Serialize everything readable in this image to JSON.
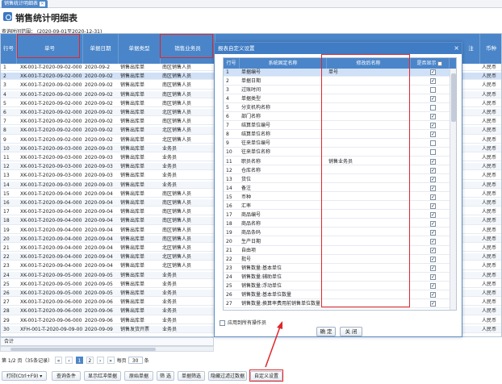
{
  "tab": {
    "label": "销售统计明细表"
  },
  "page": {
    "title": "销售统计明细表",
    "query_range": "查询时间范围： (2020-09-01至2020-12-31)"
  },
  "grid": {
    "headers": {
      "row": "行号",
      "bill_no": "单号",
      "date": "单据日期",
      "type": "单据类型",
      "staff": "销售业务员",
      "currency": "币种",
      "note": "注"
    },
    "rows": [
      {
        "row": "1",
        "bill_no": "XK-001-T-2020-09-02-000",
        "date": "2020-09-2",
        "type": "销售出库单",
        "staff": "南区销售人员",
        "currency": "人民币"
      },
      {
        "row": "2",
        "bill_no": "XK-001-T-2020-09-02-000",
        "date": "2020-09-02",
        "type": "销售出库单",
        "staff": "南区销售人员",
        "currency": "人民币"
      },
      {
        "row": "3",
        "bill_no": "XK-001-T-2020-09-02-000",
        "date": "2020-09-02",
        "type": "销售出库单",
        "staff": "南区销售人员",
        "currency": "人民币"
      },
      {
        "row": "4",
        "bill_no": "XK-001-T-2020-09-02-000",
        "date": "2020-09-02",
        "type": "销售出库单",
        "staff": "南区销售人员",
        "currency": "人民币"
      },
      {
        "row": "5",
        "bill_no": "XK-001-T-2020-09-02-000",
        "date": "2020-09-02",
        "type": "销售出库单",
        "staff": "南区销售人员",
        "currency": "人民币"
      },
      {
        "row": "6",
        "bill_no": "XK-001-T-2020-09-02-000",
        "date": "2020-09-02",
        "type": "销售出库单",
        "staff": "北区销售人员",
        "currency": "人民币"
      },
      {
        "row": "7",
        "bill_no": "XK-001-T-2020-09-02-000",
        "date": "2020-09-02",
        "type": "销售出库单",
        "staff": "南区销售人员",
        "currency": "人民币"
      },
      {
        "row": "8",
        "bill_no": "XK-001-T-2020-09-02-000",
        "date": "2020-09-02",
        "type": "销售出库单",
        "staff": "北区销售人员",
        "currency": "人民币"
      },
      {
        "row": "9",
        "bill_no": "XK-001-T-2020-09-02-000",
        "date": "2020-09-02",
        "type": "销售出库单",
        "staff": "北区销售人员",
        "currency": "人民币"
      },
      {
        "row": "10",
        "bill_no": "XK-001-T-2020-09-03-000",
        "date": "2020-09-03",
        "type": "销售出库单",
        "staff": "业务员",
        "currency": "人民币"
      },
      {
        "row": "11",
        "bill_no": "XK-001-T-2020-09-03-000",
        "date": "2020-09-03",
        "type": "销售出库单",
        "staff": "业务员",
        "currency": "人民币"
      },
      {
        "row": "12",
        "bill_no": "XK-001-T-2020-09-03-000",
        "date": "2020-09-03",
        "type": "销售出库单",
        "staff": "业务员",
        "currency": "人民币"
      },
      {
        "row": "13",
        "bill_no": "XK-001-T-2020-09-03-000",
        "date": "2020-09-03",
        "type": "销售出库单",
        "staff": "业务员",
        "currency": "人民币"
      },
      {
        "row": "14",
        "bill_no": "XK-001-T-2020-09-03-000",
        "date": "2020-09-03",
        "type": "销售出库单",
        "staff": "业务员",
        "currency": "人民币"
      },
      {
        "row": "15",
        "bill_no": "XK-001-T-2020-09-04-000",
        "date": "2020-09-04",
        "type": "销售出库单",
        "staff": "南区销售人员",
        "currency": "人民币"
      },
      {
        "row": "16",
        "bill_no": "XK-001-T-2020-09-04-000",
        "date": "2020-09-04",
        "type": "销售出库单",
        "staff": "南区销售人员",
        "currency": "人民币"
      },
      {
        "row": "17",
        "bill_no": "XK-001-T-2020-09-04-000",
        "date": "2020-09-04",
        "type": "销售出库单",
        "staff": "南区销售人员",
        "currency": "人民币"
      },
      {
        "row": "18",
        "bill_no": "XK-001-T-2020-09-04-000",
        "date": "2020-09-04",
        "type": "销售出库单",
        "staff": "南区销售人员",
        "currency": "人民币"
      },
      {
        "row": "19",
        "bill_no": "XK-001-T-2020-09-04-000",
        "date": "2020-09-04",
        "type": "销售出库单",
        "staff": "南区销售人员",
        "currency": "人民币"
      },
      {
        "row": "20",
        "bill_no": "XK-001-T-2020-09-04-000",
        "date": "2020-09-04",
        "type": "销售出库单",
        "staff": "南区销售人员",
        "currency": "人民币"
      },
      {
        "row": "21",
        "bill_no": "XK-001-T-2020-09-04-000",
        "date": "2020-09-04",
        "type": "销售出库单",
        "staff": "北区销售人员",
        "currency": "人民币"
      },
      {
        "row": "22",
        "bill_no": "XK-001-T-2020-09-04-000",
        "date": "2020-09-04",
        "type": "销售出库单",
        "staff": "北区销售人员",
        "currency": "人民币"
      },
      {
        "row": "23",
        "bill_no": "XK-001-T-2020-09-04-000",
        "date": "2020-09-04",
        "type": "销售出库单",
        "staff": "北区销售人员",
        "currency": "人民币"
      },
      {
        "row": "24",
        "bill_no": "XK-001-T-2020-09-05-000",
        "date": "2020-09-05",
        "type": "销售出库单",
        "staff": "业务员",
        "currency": "人民币"
      },
      {
        "row": "25",
        "bill_no": "XK-001-T-2020-09-05-000",
        "date": "2020-09-05",
        "type": "销售出库单",
        "staff": "业务员",
        "currency": "人民币"
      },
      {
        "row": "26",
        "bill_no": "XK-001-T-2020-09-05-000",
        "date": "2020-09-05",
        "type": "销售出库单",
        "staff": "业务员",
        "currency": "人民币"
      },
      {
        "row": "27",
        "bill_no": "XK-001-T-2020-09-06-000",
        "date": "2020-09-06",
        "type": "销售出库单",
        "staff": "业务员",
        "currency": "人民币"
      },
      {
        "row": "28",
        "bill_no": "XK-001-T-2020-09-06-000",
        "date": "2020-09-06",
        "type": "销售出库单",
        "staff": "业务员",
        "currency": "人民币"
      },
      {
        "row": "29",
        "bill_no": "XK-001-T-2020-09-06-000",
        "date": "2020-09-06",
        "type": "销售出库单",
        "staff": "业务员",
        "currency": "人民币"
      },
      {
        "row": "30",
        "bill_no": "XFH-001-T-2020-09-09-00",
        "date": "2020-09-09",
        "type": "销售发货开票",
        "staff": "业务员",
        "currency": "人民币"
      }
    ]
  },
  "total_label": "合计",
  "pager": {
    "info": "第 1/2 页（35条记录）",
    "first": "«",
    "prev": "‹",
    "current": "1",
    "page2": "2",
    "next": "›",
    "last": "»",
    "per_page_label": "每页",
    "per_page_value": "30",
    "unit": "条"
  },
  "toolbar": {
    "print": "打印(Ctrl+F9) ▾",
    "query": "查询条件",
    "red": "显示红冲单据",
    "original": "原始单据",
    "filter": "筛 选",
    "bill_filter": "单据筛选",
    "hide_filtered": "隐藏过滤过数据",
    "custom": "自定义设置"
  },
  "dialog": {
    "title": "报表自定义设置",
    "close": "×",
    "headers": {
      "row": "行号",
      "sys_name": "系统固定名称",
      "custom_name": "修改后名称",
      "show": "是否显示"
    },
    "rows": [
      {
        "row": "1",
        "sys_name": "单据编号",
        "custom_name": "单号",
        "show": true
      },
      {
        "row": "2",
        "sys_name": "单据日期",
        "custom_name": "",
        "show": true
      },
      {
        "row": "3",
        "sys_name": "过账时间",
        "custom_name": "",
        "show": false
      },
      {
        "row": "4",
        "sys_name": "单据类型",
        "custom_name": "",
        "show": true
      },
      {
        "row": "5",
        "sys_name": "分支机构名称",
        "custom_name": "",
        "show": false
      },
      {
        "row": "6",
        "sys_name": "部门名称",
        "custom_name": "",
        "show": true
      },
      {
        "row": "7",
        "sys_name": "结算单位编号",
        "custom_name": "",
        "show": true
      },
      {
        "row": "8",
        "sys_name": "结算单位名称",
        "custom_name": "",
        "show": true
      },
      {
        "row": "9",
        "sys_name": "往来单位编号",
        "custom_name": "",
        "show": false
      },
      {
        "row": "10",
        "sys_name": "往来单位名称",
        "custom_name": "",
        "show": false
      },
      {
        "row": "11",
        "sys_name": "职员名称",
        "custom_name": "销售业务员",
        "show": true
      },
      {
        "row": "12",
        "sys_name": "仓库名称",
        "custom_name": "",
        "show": true
      },
      {
        "row": "13",
        "sys_name": "货位",
        "custom_name": "",
        "show": true
      },
      {
        "row": "14",
        "sys_name": "备注",
        "custom_name": "",
        "show": true
      },
      {
        "row": "15",
        "sys_name": "币种",
        "custom_name": "",
        "show": true
      },
      {
        "row": "16",
        "sys_name": "汇率",
        "custom_name": "",
        "show": true
      },
      {
        "row": "17",
        "sys_name": "商品编号",
        "custom_name": "",
        "show": true
      },
      {
        "row": "18",
        "sys_name": "商品名称",
        "custom_name": "",
        "show": true
      },
      {
        "row": "19",
        "sys_name": "商品条码",
        "custom_name": "",
        "show": true
      },
      {
        "row": "20",
        "sys_name": "生产日期",
        "custom_name": "",
        "show": true
      },
      {
        "row": "21",
        "sys_name": "自由项",
        "custom_name": "",
        "show": true
      },
      {
        "row": "22",
        "sys_name": "批号",
        "custom_name": "",
        "show": true
      },
      {
        "row": "23",
        "sys_name": "销售数量:基本单位",
        "custom_name": "",
        "show": true
      },
      {
        "row": "24",
        "sys_name": "销售数量:辅助单位",
        "custom_name": "",
        "show": true
      },
      {
        "row": "25",
        "sys_name": "销售数量:浮动单位",
        "custom_name": "",
        "show": true
      },
      {
        "row": "26",
        "sys_name": "销售数量:基本单位数量",
        "custom_name": "",
        "show": true
      },
      {
        "row": "27",
        "sys_name": "销售数量:换算率费用前销售单位数量",
        "custom_name": "",
        "show": true
      }
    ],
    "apply_all": "应用到所有操作员",
    "ok": "确 定",
    "close_btn": "关 闭"
  },
  "colors": {
    "header_blue": "#4a85c9",
    "highlight_red": "#e0262b",
    "selected_row": "#cfe0f7"
  }
}
